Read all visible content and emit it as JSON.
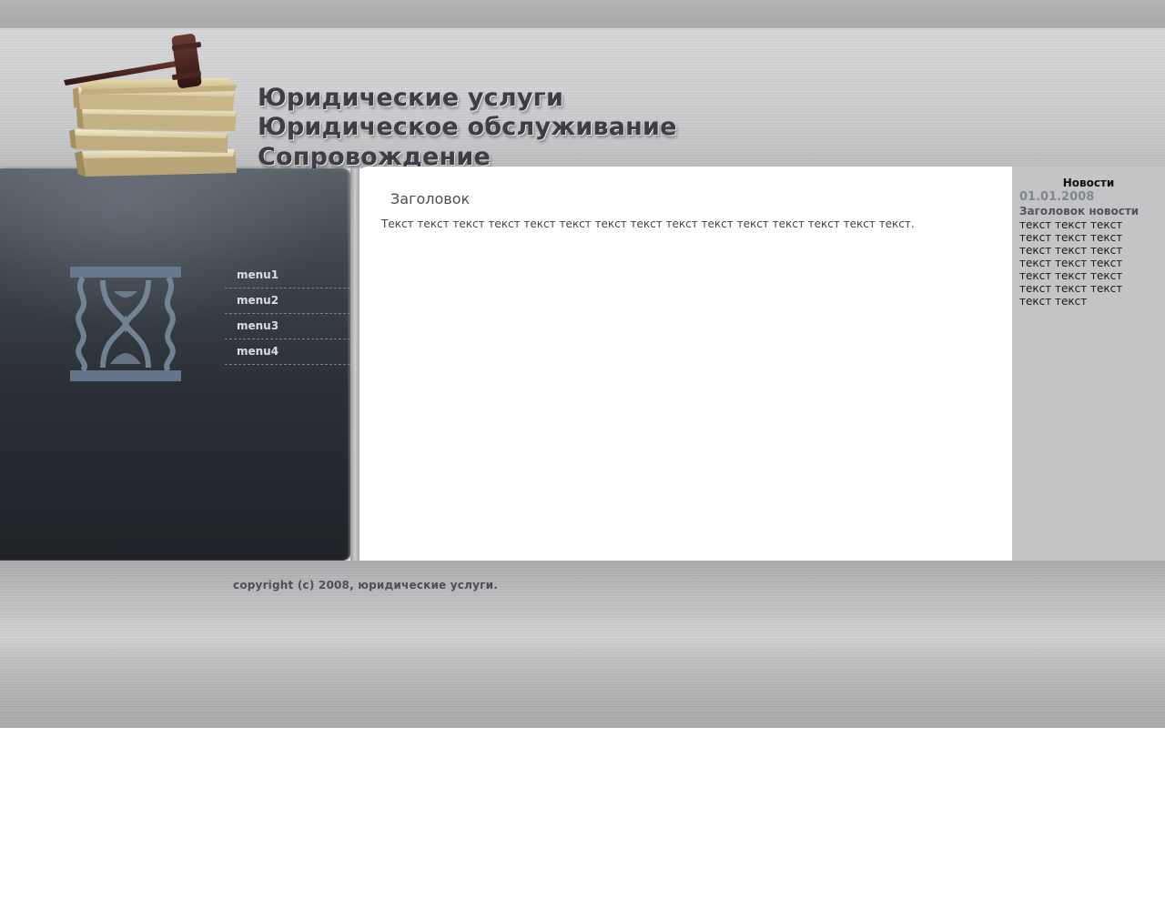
{
  "header": {
    "headlines": [
      "Юридические услуги",
      "Юридическое обслуживание",
      "Сопровождение"
    ],
    "logo_icon": "books-gavel-icon",
    "emblem_icon": "hourglass-icon"
  },
  "menu": {
    "items": [
      "menu1",
      "menu2",
      "menu3",
      "menu4"
    ]
  },
  "content": {
    "title": "Заголовок",
    "text": "Текст текст текст текст текст текст текст текст текст текст текст текст текст текст текст."
  },
  "news": {
    "heading": "Новости",
    "date": "01.01.2008",
    "title": "Заголовок новости",
    "body": "текст текст текст текст текст текст текст текст текст текст текст текст текст текст текст текст текст текст текст текст"
  },
  "footer": {
    "copyright": "copyright (c) 2008, юридические услуги."
  },
  "colors": {
    "dark_panel": "#2b3037",
    "news_bg": "#c4c4c6",
    "menu_text": "#d9dde2",
    "date_color": "#7f8791"
  }
}
